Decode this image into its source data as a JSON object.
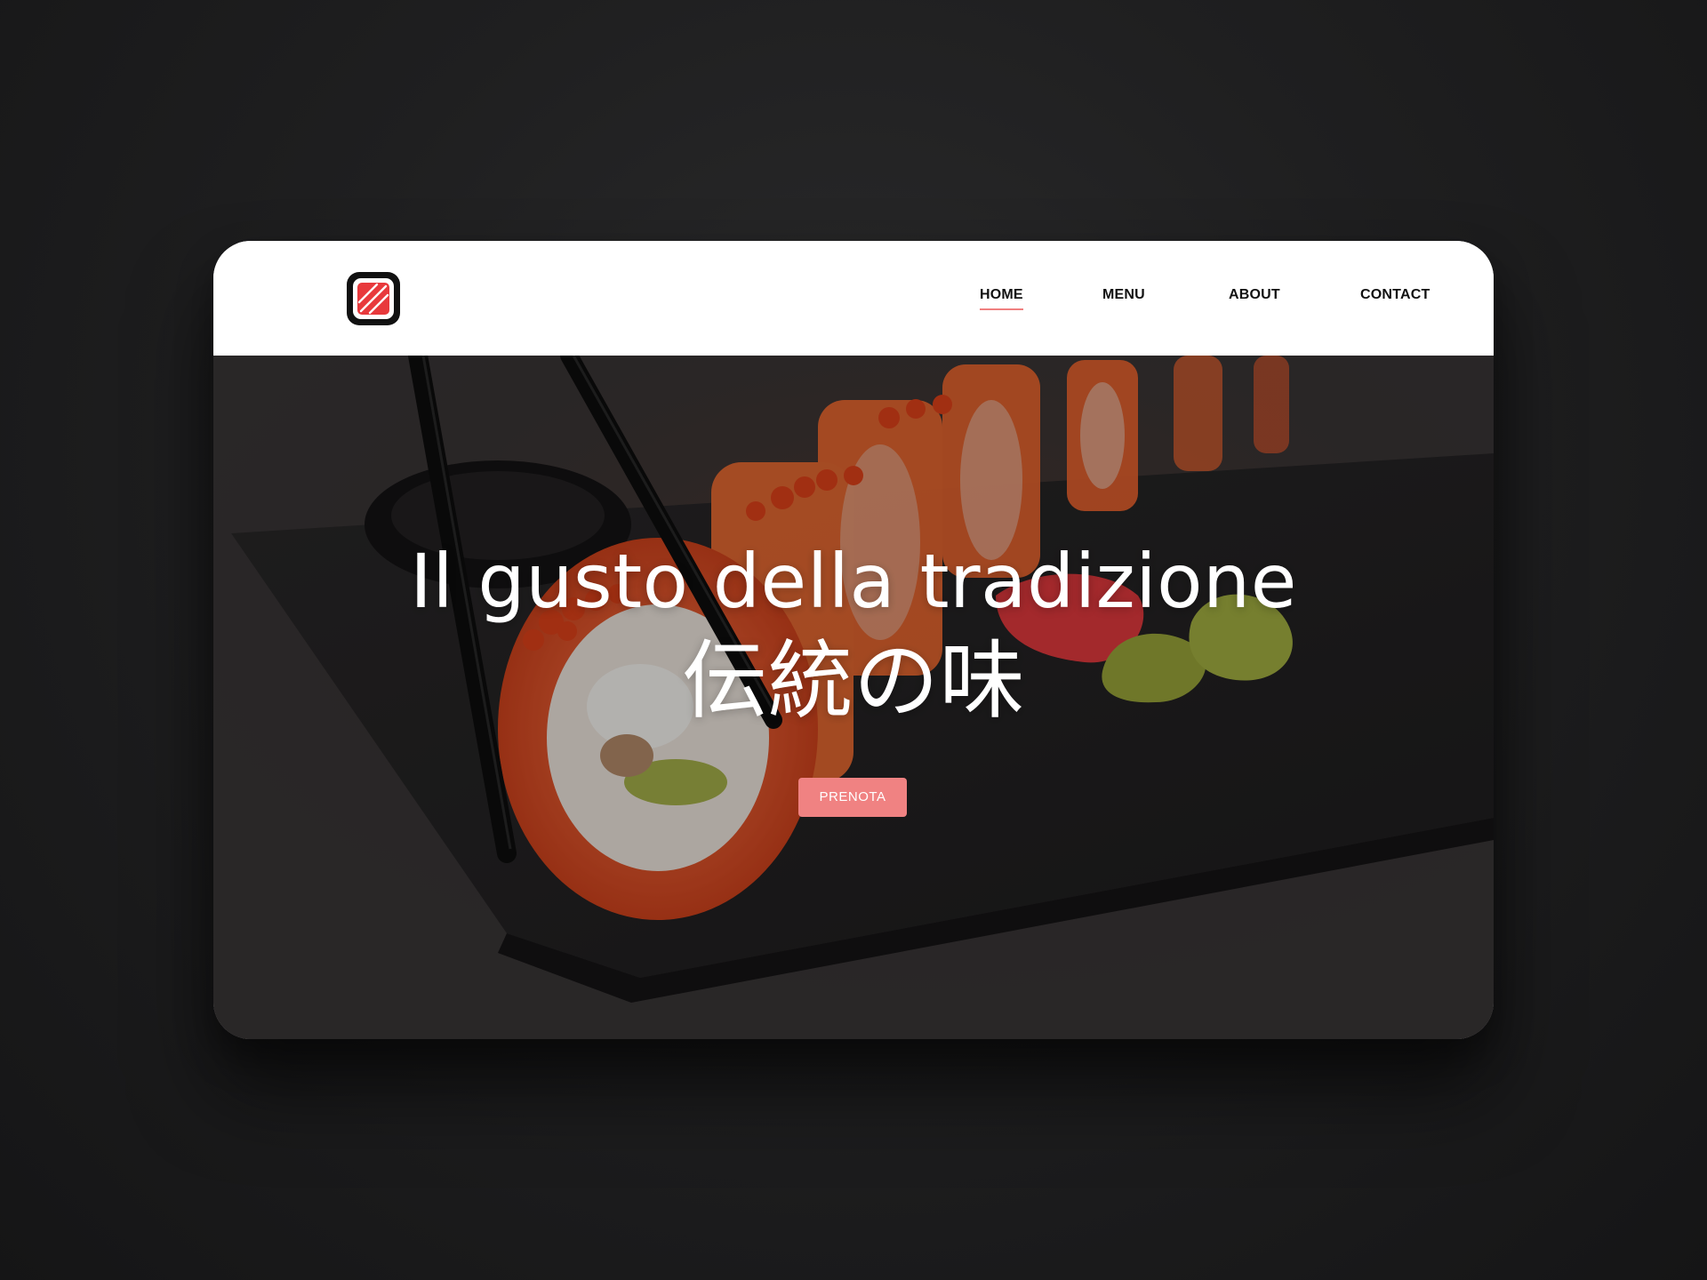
{
  "header": {
    "logo_icon": "sushi-salmon-logo-icon",
    "nav": [
      {
        "label": "HOME",
        "active": true
      },
      {
        "label": "MENU",
        "active": false
      },
      {
        "label": "ABOUT",
        "active": false
      },
      {
        "label": "CONTACT",
        "active": false
      }
    ]
  },
  "hero": {
    "title": "Il gusto della tradizione",
    "subtitle": "伝統の味",
    "cta_label": "PRENOTA",
    "background_image": "sushi-rolls-with-chopsticks-photo"
  },
  "colors": {
    "accent": "#f08282",
    "header_bg": "#ffffff",
    "page_bg": "#1f1f20",
    "logo_red": "#e8393c"
  }
}
